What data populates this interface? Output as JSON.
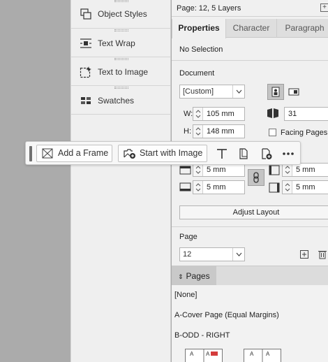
{
  "dock": {
    "items": [
      {
        "label": "Object Styles",
        "icon": "object-styles-icon"
      },
      {
        "label": "Text Wrap",
        "icon": "text-wrap-icon"
      },
      {
        "label": "Text to Image",
        "icon": "text-to-image-icon"
      },
      {
        "label": "Swatches",
        "icon": "swatches-icon"
      }
    ]
  },
  "props": {
    "page_info": "Page: 12, 5 Layers",
    "tabs": [
      {
        "label": "Properties",
        "active": true
      },
      {
        "label": "Character",
        "active": false
      },
      {
        "label": "Paragraph",
        "active": false
      }
    ],
    "selection": "No Selection",
    "document": {
      "heading": "Document",
      "preset": "[Custom]",
      "width_label": "W:",
      "width": "105 mm",
      "height_label": "H:",
      "height": "148 mm",
      "pages": "31",
      "facing_pages_label": "Facing Pages",
      "facing_pages_checked": false
    },
    "margins": {
      "top": "5 mm",
      "bottom": "5 mm",
      "inside": "5 mm",
      "outside": "5 mm"
    },
    "adjust_layout_label": "Adjust Layout",
    "page_section": {
      "heading": "Page",
      "current": "12"
    }
  },
  "pages_panel": {
    "tab_label": "Pages",
    "masters": [
      "[None]",
      "A-Cover Page (Equal Margins)",
      "B-ODD - RIGHT"
    ]
  },
  "context_bar": {
    "add_frame_label": "Add a Frame",
    "start_with_image_label": "Start with Image"
  },
  "colors": {
    "pasteboard": "#ababab",
    "panel": "#f0f0f0",
    "accent_gray": "#c4c4c4"
  }
}
